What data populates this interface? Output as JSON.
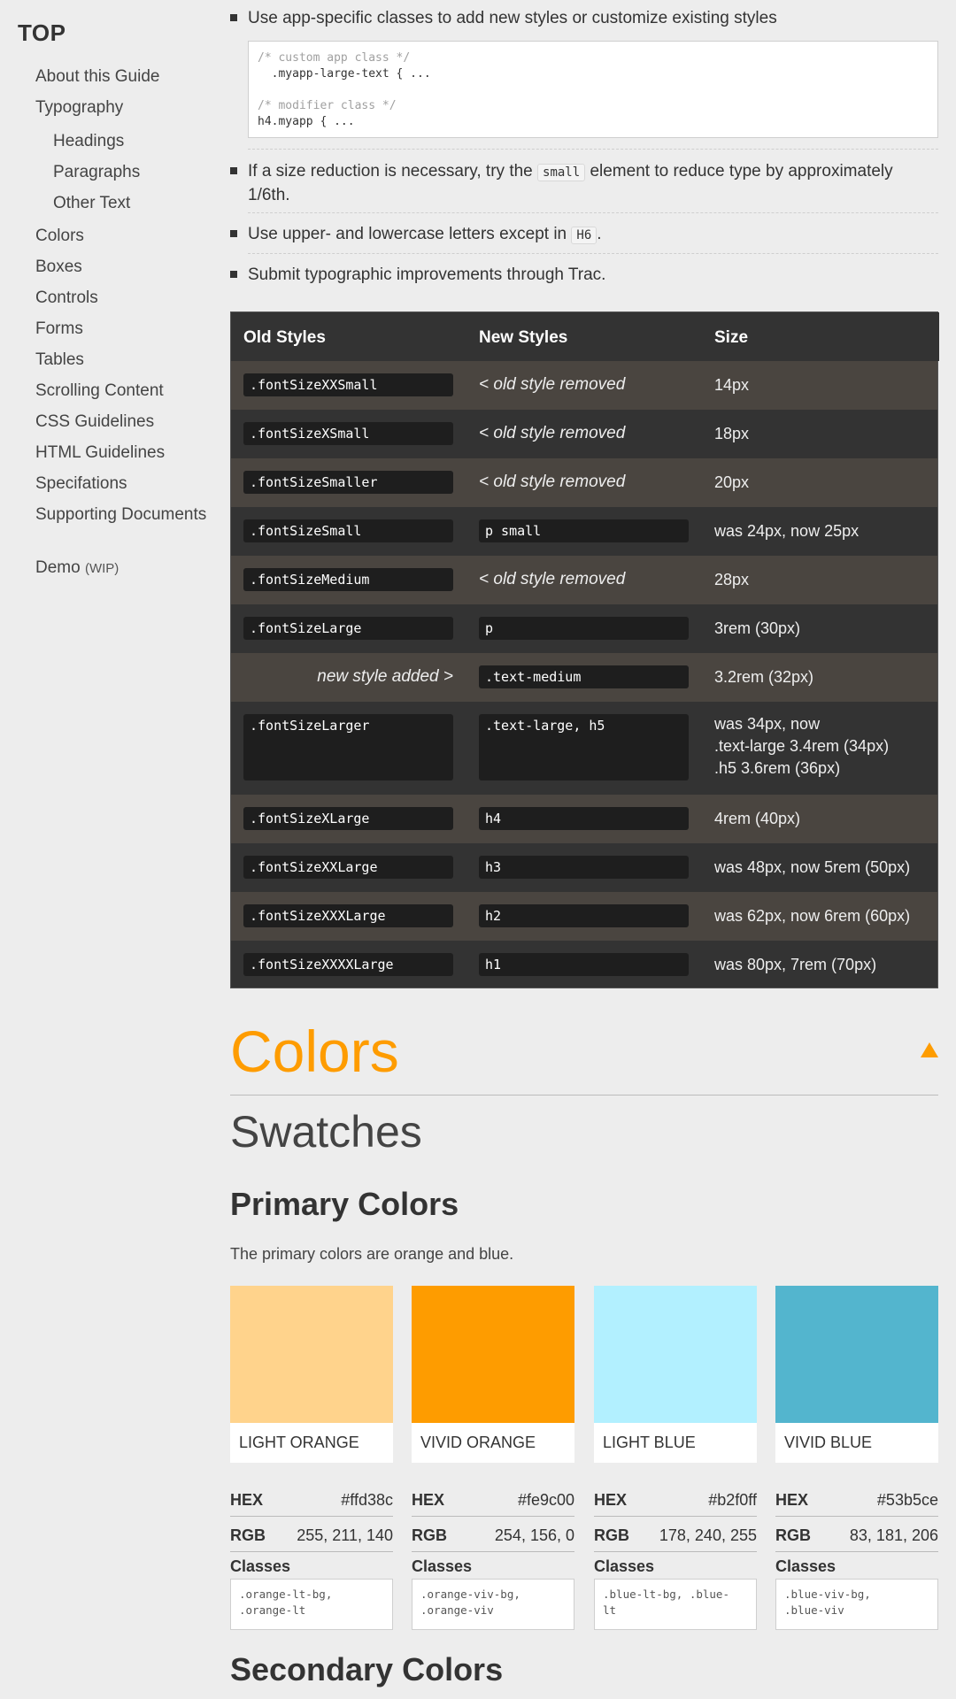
{
  "sidebar": {
    "top": "TOP",
    "items": [
      {
        "label": "About this Guide"
      },
      {
        "label": "Typography"
      },
      {
        "label": "Headings"
      },
      {
        "label": "Paragraphs"
      },
      {
        "label": "Other Text"
      },
      {
        "label": "Colors"
      },
      {
        "label": "Boxes"
      },
      {
        "label": "Controls"
      },
      {
        "label": "Forms"
      },
      {
        "label": "Tables"
      },
      {
        "label": "Scrolling Content"
      },
      {
        "label": "CSS Guidelines"
      },
      {
        "label": "HTML Guidelines"
      },
      {
        "label": "Specifations"
      },
      {
        "label": "Supporting Documents"
      }
    ],
    "demo": "Demo",
    "demo_badge": "(WIP)"
  },
  "guidelines": {
    "b1": "Use app-specific classes to add new styles or customize existing styles",
    "code": [
      "/* custom app class */",
      "  .myapp-large-text { ...",
      "",
      "/* modifier class */",
      "h4.myapp { ..."
    ],
    "b2_pre": "If a size reduction is necessary, try the ",
    "b2_code": "small",
    "b2_post": " element to reduce type by approximately",
    "b2_line2": "1/6th.",
    "b3_pre": "Use upper- and lowercase letters except in ",
    "b3_code": "H6",
    "b3_post": ".",
    "b4": "Submit typographic improvements through Trac."
  },
  "table": {
    "headers": [
      "Old Styles",
      "New Styles",
      "Size"
    ],
    "rows": [
      {
        "old": ".fontSizeXXSmall",
        "new_note": "< old style removed",
        "size": "14px"
      },
      {
        "old": ".fontSizeXSmall",
        "new_note": "< old style removed",
        "size": "18px"
      },
      {
        "old": ".fontSizeSmaller",
        "new_note": "< old style removed",
        "size": "20px"
      },
      {
        "old": ".fontSizeSmall",
        "new": "p small",
        "size": "was 24px, now 25px"
      },
      {
        "old": ".fontSizeMedium",
        "new_note": "< old style removed",
        "size": "28px"
      },
      {
        "old": ".fontSizeLarge",
        "new": "p",
        "size": "3rem (30px)"
      },
      {
        "old_note": "new style added >",
        "new": ".text-medium",
        "size": "3.2rem (32px)"
      },
      {
        "old": ".fontSizeLarger",
        "new": ".text-large, h5",
        "size_lines": [
          "was 34px, now",
          ".text-large 3.4rem (34px)",
          ".h5 3.6rem (36px)"
        ]
      },
      {
        "old": ".fontSizeXLarge",
        "new": "h4",
        "size": "4rem (40px)"
      },
      {
        "old": ".fontSizeXXLarge",
        "new": "h3",
        "size": "was 48px, now 5rem (50px)"
      },
      {
        "old": ".fontSizeXXXLarge",
        "new": "h2",
        "size": "was 62px, now 6rem (60px)"
      },
      {
        "old": ".fontSizeXXXXLarge",
        "new": "h1",
        "size": "was 80px, 7rem (70px)"
      }
    ]
  },
  "colors": {
    "heading": "Colors",
    "accent": "#fe9c00",
    "swatches_heading": "Swatches",
    "primary_heading": "Primary Colors",
    "primary_desc": "The primary colors are orange and blue.",
    "hex_label": "HEX",
    "rgb_label": "RGB",
    "classes_label": "Classes",
    "swatches": [
      {
        "name": "LIGHT ORANGE",
        "color": "#ffd38c",
        "hex": "#ffd38c",
        "rgb": "255, 211, 140",
        "classes": [
          ".orange-lt-bg,",
          ".orange-lt"
        ]
      },
      {
        "name": "VIVID ORANGE",
        "color": "#fe9c00",
        "hex": "#fe9c00",
        "rgb": "254, 156, 0",
        "classes": [
          ".orange-viv-bg,",
          ".orange-viv"
        ]
      },
      {
        "name": "LIGHT BLUE",
        "color": "#b2f0ff",
        "hex": "#b2f0ff",
        "rgb": "178, 240, 255",
        "classes": [
          ".blue-lt-bg, .blue-",
          "lt"
        ]
      },
      {
        "name": "VIVID BLUE",
        "color": "#53b5ce",
        "hex": "#53b5ce",
        "rgb": "83, 181, 206",
        "classes": [
          ".blue-viv-bg,",
          ".blue-viv"
        ]
      }
    ],
    "secondary_heading": "Secondary Colors"
  }
}
